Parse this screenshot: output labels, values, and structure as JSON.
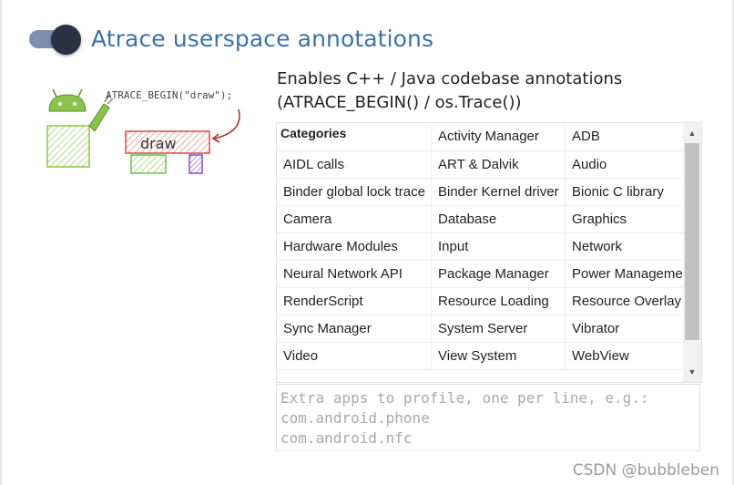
{
  "section": {
    "title": "Atrace userspace annotations",
    "toggle_on": true
  },
  "illustration": {
    "code_label": "ATRACE_BEGIN(\"draw\");",
    "slice_label": "draw"
  },
  "description": {
    "line1": "Enables C++ / Java codebase annotations",
    "line2": "(ATRACE_BEGIN() / os.Trace())"
  },
  "categories": {
    "header": "Categories",
    "items": [
      "Activity Manager",
      "ADB",
      "AIDL calls",
      "ART & Dalvik",
      "Audio",
      "Binder global lock trace",
      "Binder Kernel driver",
      "Bionic C library",
      "Camera",
      "Database",
      "Graphics",
      "Hardware Modules",
      "Input",
      "Network",
      "Neural Network API",
      "Package Manager",
      "Power Manageme",
      "RenderScript",
      "Resource Loading",
      "Resource Overlay",
      "Sync Manager",
      "System Server",
      "Vibrator",
      "Video",
      "View System",
      "WebView"
    ]
  },
  "extra_apps": {
    "placeholder": "Extra apps to profile, one per line, e.g.:\ncom.android.phone\ncom.android.nfc"
  },
  "watermark": "CSDN @bubbleben",
  "colors": {
    "title": "#3e71a4",
    "toggle_track": "#7d8fae",
    "toggle_knob": "#283243"
  }
}
